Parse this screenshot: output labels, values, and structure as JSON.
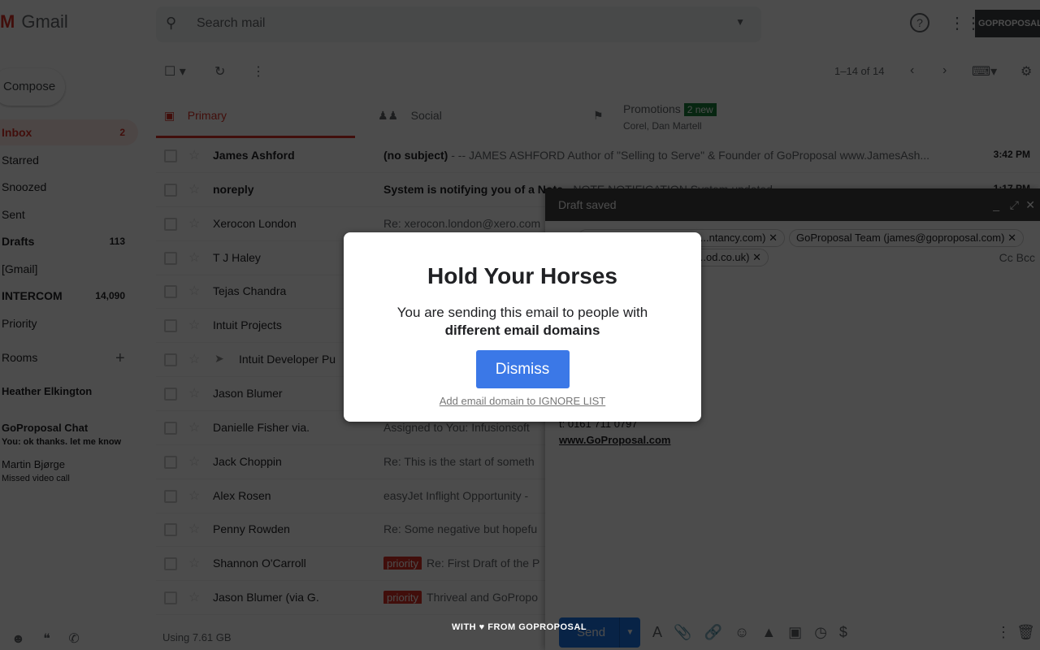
{
  "app": {
    "name": "Gmail",
    "search_placeholder": "Search mail",
    "account": "GOPROPOSAL"
  },
  "sidebar": {
    "compose": "Compose",
    "items": [
      {
        "label": "Inbox",
        "count": "2"
      },
      {
        "label": "Starred",
        "count": ""
      },
      {
        "label": "Snoozed",
        "count": ""
      },
      {
        "label": "Sent",
        "count": ""
      },
      {
        "label": "Drafts",
        "count": "113"
      },
      {
        "label": "[Gmail]",
        "count": ""
      },
      {
        "label": "INTERCOM",
        "count": "14,090"
      },
      {
        "label": "Priority",
        "count": ""
      }
    ],
    "rooms_label": "Rooms",
    "chats": [
      {
        "name": "Heather Elkington",
        "msg": ""
      },
      {
        "name": "GoProposal Chat",
        "msg": "You: ok thanks. let me know"
      },
      {
        "name": "Martin Bjørge",
        "msg": "Missed video call"
      }
    ],
    "storage": "Using 7.61 GB"
  },
  "toolbar": {
    "pagination": "1–14 of 14"
  },
  "tabs": [
    {
      "label": "Primary"
    },
    {
      "label": "Social"
    },
    {
      "label": "Promotions",
      "badge": "2 new",
      "sub": "Corel, Dan Martell"
    }
  ],
  "emails": [
    {
      "from": "James Ashford",
      "subject": "(no subject)",
      "snippet": " - -- JAMES ASHFORD Author of \"Selling to Serve\" & Founder of GoProposal www.JamesAsh...",
      "time": "3:42 PM",
      "unread": true,
      "tag": ""
    },
    {
      "from": "noreply",
      "subject": "System is notifying you of a Note",
      "snippet": " - NOTE NOTIFICATION System updated ...",
      "time": "1:17 PM",
      "unread": true,
      "tag": ""
    },
    {
      "from": "Xerocon London",
      "subject": "",
      "snippet": "Re: xerocon.london@xero.com",
      "time": "",
      "unread": false,
      "tag": ""
    },
    {
      "from": "T J Haley",
      "subject": "",
      "snippet": "",
      "time": "",
      "unread": false,
      "tag": ""
    },
    {
      "from": "Tejas Chandra",
      "subject": "",
      "snippet": "",
      "time": "",
      "unread": false,
      "tag": ""
    },
    {
      "from": "Intuit Projects",
      "subject": "",
      "snippet": "",
      "time": "",
      "unread": false,
      "tag": ""
    },
    {
      "from": "Intuit Developer Pu",
      "subject": "",
      "snippet": "",
      "time": "",
      "unread": false,
      "tag": ""
    },
    {
      "from": "Jason Blumer",
      "subject": "",
      "snippet": "",
      "time": "",
      "unread": false,
      "tag": ""
    },
    {
      "from": "Danielle Fisher via.",
      "subject": "",
      "snippet": "Assigned to You: Infusionsoft",
      "time": "",
      "unread": false,
      "tag": ""
    },
    {
      "from": "Jack Choppin",
      "subject": "",
      "snippet": "Re: This is the start of someth",
      "time": "",
      "unread": false,
      "tag": ""
    },
    {
      "from": "Alex Rosen",
      "subject": "",
      "snippet": "easyJet Inflight Opportunity -",
      "time": "",
      "unread": false,
      "tag": ""
    },
    {
      "from": "Penny Rowden",
      "subject": "",
      "snippet": "Re: Some negative but hopefu",
      "time": "",
      "unread": false,
      "tag": ""
    },
    {
      "from": "Shannon O'Carroll",
      "subject": "",
      "snippet": "Re: First Draft of the P",
      "time": "",
      "unread": false,
      "tag": "priority"
    },
    {
      "from": "Jason Blumer (via G.",
      "subject": "",
      "snippet": "Thriveal and GoPropo",
      "time": "",
      "unread": false,
      "tag": "priority"
    }
  ],
  "compose": {
    "title": "Draft saved",
    "chips": [
      "...ntancy.com)",
      "GoProposal Team (james@goproposal.com)",
      "...od.co.uk)"
    ],
    "cc_bcc": "Cc Bcc",
    "phone": "t: 0161 711 0797",
    "website": "www.GoProposal.com",
    "send": "Send"
  },
  "modal": {
    "title": "Hold Your Horses",
    "line1": "You are sending this email to people with",
    "line2": "different email domains",
    "dismiss": "Dismiss",
    "ignore_link": "Add email domain to IGNORE LIST"
  },
  "footer": {
    "with": "WITH",
    "from": "FROM",
    "brand": "GOPROPOSAL"
  },
  "colors": {
    "accent": "#3b78e7",
    "gmail_red": "#d93025",
    "overlay": "#40434c"
  }
}
